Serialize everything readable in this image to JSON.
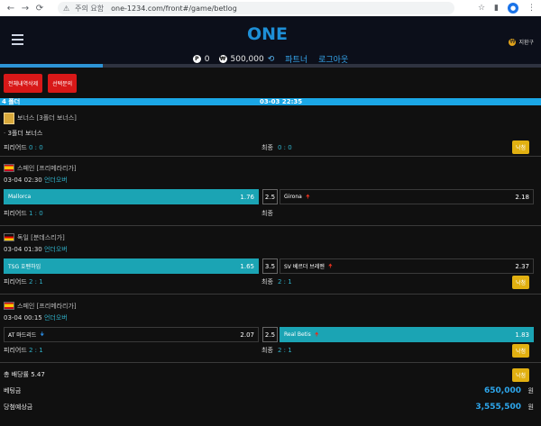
{
  "browser": {
    "security_label": "주의 요함",
    "url": "one-1234.com/front#/game/betlog"
  },
  "header": {
    "logo": "ONE",
    "logo_sub": "",
    "user_label": "지환구",
    "points": "0",
    "money": "500,000",
    "partner_link": "파트너",
    "logout_link": "로그아웃"
  },
  "progress_fraction": 0.19,
  "actions": {
    "delete_all": "전체내역삭제",
    "delete_selected": "선택문의"
  },
  "bet": {
    "title": "4 폴더",
    "datetime": "03-03 22:35",
    "bonus": {
      "league": "보너스 [3폴더 보너스]",
      "name": "3폴더 보너스",
      "period_label": "피리어드",
      "period_score": "0 : 0",
      "final_label": "최종",
      "final_score": "0 : 0",
      "status": "낙첨"
    },
    "games": [
      {
        "league": "스페인 [프리메라리가]",
        "flag": "es",
        "time": "03-04 02:30",
        "market": "언더오버",
        "home": "Mallorca",
        "home_odds": "1.76",
        "line": "2.5",
        "away": "Girona",
        "away_odds": "2.18",
        "period_label": "피리어드",
        "period_score": "1 : 0",
        "final_label": "최종",
        "final_score": "",
        "status": ""
      },
      {
        "league": "독일 [분데스리가]",
        "flag": "de",
        "time": "03-04 01:30",
        "market": "언더오버",
        "home": "TSG 호펜하임",
        "home_odds": "1.65",
        "line": "3.5",
        "away": "SV 베르더 브레멘",
        "away_odds": "2.37",
        "period_label": "피리어드",
        "period_score": "2 : 1",
        "final_label": "최종",
        "final_score": "2 : 1",
        "status": "낙첨"
      },
      {
        "league": "스페인 [프리메라리가]",
        "flag": "es",
        "time": "03-04 00:15",
        "market": "언더오버",
        "home": "AT 마드리드",
        "home_odds": "2.07",
        "line": "2.5",
        "away": "Real Betis",
        "away_odds": "1.83",
        "period_label": "피리어드",
        "period_score": "2 : 1",
        "final_label": "최종",
        "final_score": "2 : 1",
        "status": "낙첨"
      }
    ],
    "summary": {
      "total_odds_label": "총 배당률",
      "total_odds": "5.47",
      "status": "낙첨",
      "bet_label": "베팅금",
      "bet_amount": "650,000",
      "win_label": "당첨예상금",
      "win_amount": "3,555,500",
      "unit": "원"
    }
  }
}
